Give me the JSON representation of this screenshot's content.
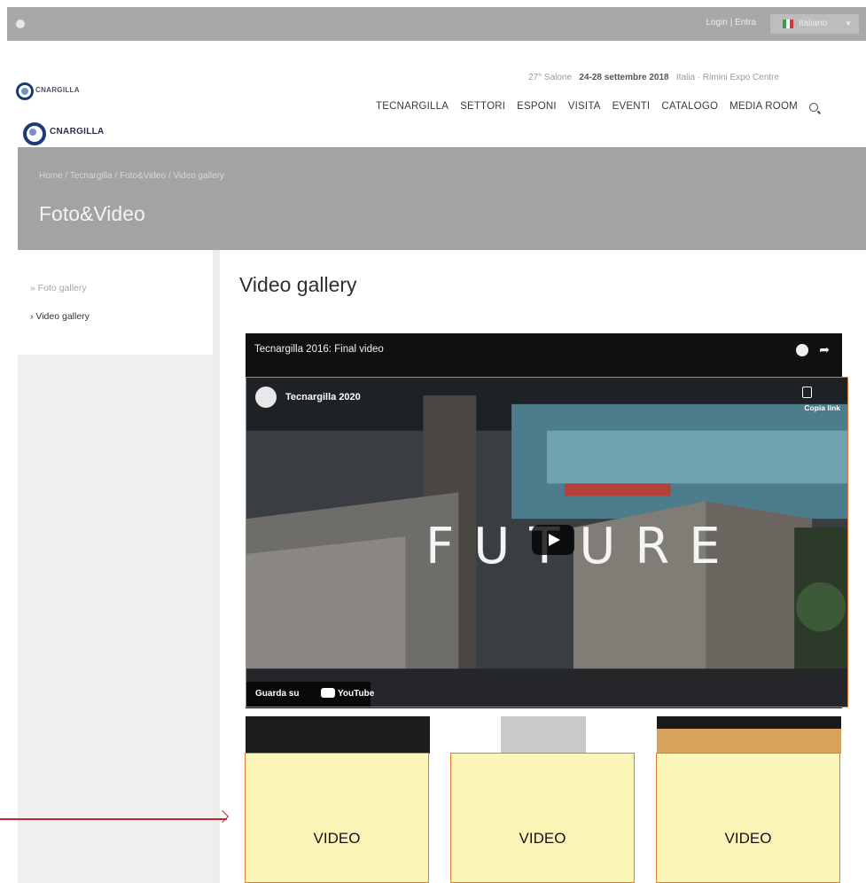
{
  "topbar": {
    "login": "Login  |  Entra",
    "language": "Italiano"
  },
  "header": {
    "logo_text": "CNARGILLA",
    "edition_prefix": "27° Salone",
    "edition_dates": "24-28 settembre 2018",
    "edition_venue": "Italia · Rimini Expo Centre",
    "nav": [
      "TECNARGILLA",
      "SETTORI",
      "ESPONI",
      "VISITA",
      "EVENTI",
      "CATALOGO",
      "MEDIA ROOM"
    ]
  },
  "hero": {
    "breadcrumb": "Home / Tecnargilla / Foto&Video / Video gallery",
    "title": "Foto&Video"
  },
  "sidebar": {
    "items": [
      {
        "label": "» Foto gallery"
      },
      {
        "label": "› Video gallery"
      }
    ]
  },
  "main": {
    "title": "Video gallery",
    "player_title": "Tecnargilla 2016: Final video",
    "embed": {
      "channel": "Tecnargilla 2020",
      "copy_link": "Copia link",
      "overlay_word": "FUTURE",
      "watch_on": "Guarda su",
      "youtube": "YouTube"
    },
    "thumbnails": [
      {
        "label": "VIDEO"
      },
      {
        "label": "VIDEO"
      },
      {
        "label": "VIDEO"
      }
    ]
  },
  "colors": {
    "accent_border": "#e07a2e",
    "placeholder_fill": "#fbf5b8",
    "annotation_arrow": "#c0282b"
  }
}
